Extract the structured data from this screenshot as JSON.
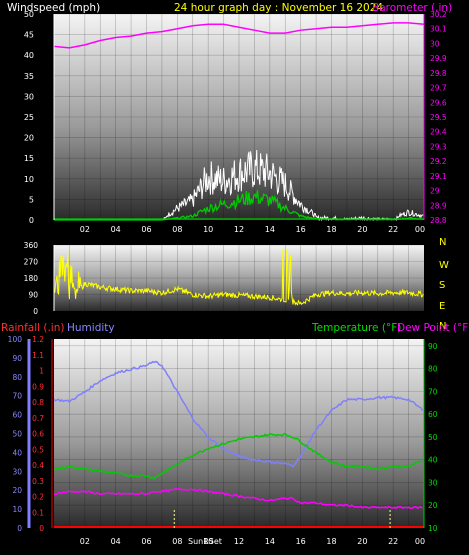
{
  "header": {
    "left_title": "Windspeed (mph)",
    "center_title": "24 hour graph day : November 16 2024",
    "right_title": "Barometer (.in)"
  },
  "colors": {
    "background": "#000000",
    "wind_axis": "#ffffff",
    "barometer": "#ff00ff",
    "gust": "#ffffff",
    "avg_wind": "#00cc00",
    "direction": "#ffff00",
    "rainfall": "#ff0000",
    "humidity": "#7f7fff",
    "temperature": "#00cc00",
    "dewpoint": "#ff00ff",
    "sunrise_marker": "#ffff88"
  },
  "x_ticks": [
    "02",
    "04",
    "06",
    "08",
    "10",
    "12",
    "14",
    "16",
    "18",
    "20",
    "22",
    "00"
  ],
  "compass": [
    "N",
    "W",
    "S",
    "E",
    "N"
  ],
  "chart_data": [
    {
      "type": "line",
      "x": [
        0,
        1,
        2,
        3,
        4,
        5,
        6,
        7,
        8,
        9,
        10,
        11,
        12,
        13,
        14,
        15,
        16,
        17,
        18,
        19,
        20,
        21,
        22,
        23,
        24
      ],
      "series": [
        {
          "name": "Barometer (.in)",
          "axis": "right",
          "values": [
            29.98,
            29.97,
            29.99,
            30.02,
            30.04,
            30.05,
            30.07,
            30.08,
            30.1,
            30.12,
            30.13,
            30.13,
            30.11,
            30.09,
            30.07,
            30.07,
            30.09,
            30.1,
            30.11,
            30.11,
            30.12,
            30.13,
            30.14,
            30.14,
            30.13
          ]
        },
        {
          "values": [
            0,
            0,
            0,
            0.3,
            0,
            0,
            0,
            0.2,
            3,
            5,
            11,
            10,
            12,
            13,
            12,
            9,
            4,
            1,
            1,
            0.5,
            1,
            0.5,
            0.5,
            2,
            1
          ]
        },
        {
          "values": [
            0,
            0,
            0,
            0,
            0,
            0,
            0,
            0,
            0.5,
            1,
            3,
            4,
            5,
            6,
            5,
            3,
            1,
            0.3,
            0.2,
            0.1,
            0.2,
            0.1,
            0.1,
            0.5,
            0.2
          ]
        }
      ],
      "left_axis": {
        "label": "Windspeed (mph)",
        "ylim": [
          0,
          50
        ],
        "ticks": [
          0,
          5,
          10,
          15,
          20,
          25,
          30,
          35,
          40,
          45,
          50
        ]
      },
      "right_axis": {
        "label": "Barometer (.in)",
        "ylim": [
          28.8,
          30.2
        ],
        "ticks": [
          "28.8",
          "28.9",
          "29",
          "29.1",
          "29.2",
          "29.3",
          "29.4",
          "29.5",
          "29.6",
          "29.7",
          "29.8",
          "29.9",
          "30",
          "30.1",
          "30.2"
        ]
      }
    },
    {
      "type": "line",
      "x": [
        0,
        0.5,
        1,
        1.5,
        2,
        3,
        4,
        5,
        6,
        7,
        8,
        9,
        10,
        11,
        12,
        13,
        14,
        15,
        15.5,
        16,
        17,
        18,
        19,
        20,
        21,
        22,
        23,
        24
      ],
      "series": [
        {
          "values": [
            90,
            340,
            180,
            100,
            150,
            130,
            120,
            110,
            110,
            100,
            120,
            90,
            80,
            90,
            85,
            80,
            75,
            60,
            50,
            40,
            90,
            100,
            95,
            100,
            95,
            100,
            100,
            90
          ]
        }
      ],
      "left_axis": {
        "ticks": [
          0,
          90,
          180,
          270,
          360
        ],
        "ylim": [
          0,
          360
        ]
      },
      "right_axis": {
        "ticks": [
          "N",
          "W",
          "S",
          "E",
          "N"
        ]
      }
    },
    {
      "type": "line",
      "x": [
        0,
        1,
        2,
        3,
        4,
        5,
        6,
        6.5,
        7,
        8,
        9,
        10,
        11,
        12,
        13,
        14,
        15,
        15.5,
        16,
        17,
        18,
        19,
        20,
        21,
        22,
        23,
        24
      ],
      "series": [
        {
          "name": "Humidity",
          "axis": "humidity",
          "values": [
            68,
            67,
            72,
            78,
            82,
            84,
            86,
            88,
            86,
            72,
            58,
            48,
            42,
            38,
            36,
            35,
            34,
            33,
            38,
            52,
            62,
            68,
            68,
            69,
            69,
            68,
            62
          ]
        },
        {
          "name": "Temperature (°F)",
          "axis": "right",
          "values": [
            36,
            37,
            36,
            35,
            34,
            33,
            33,
            32,
            34,
            38,
            42,
            45,
            47,
            49,
            50,
            51,
            51,
            50,
            48,
            43,
            39,
            37,
            37,
            36,
            37,
            37,
            40
          ]
        },
        {
          "name": "Dew Point (°F)",
          "axis": "right",
          "values": [
            25,
            26,
            26,
            25,
            25,
            25,
            25,
            26,
            26,
            27,
            27,
            26,
            25,
            24,
            23,
            22,
            23,
            23,
            21,
            21,
            20,
            20,
            19,
            19,
            19,
            19,
            19
          ]
        },
        {
          "name": "Rainfall (.in)",
          "axis": "rain",
          "values": [
            0,
            0,
            0,
            0,
            0,
            0,
            0,
            0,
            0,
            0,
            0,
            0,
            0,
            0,
            0,
            0,
            0,
            0,
            0,
            0,
            0,
            0,
            0,
            0,
            0,
            0,
            0
          ]
        }
      ],
      "rain_axis": {
        "label": "Rainfall (.in)",
        "ylim": [
          0,
          1.2
        ],
        "ticks": [
          "0",
          "0.1",
          "0.2",
          "0.3",
          "0.4",
          "0.5",
          "0.6",
          "0.7",
          "0.8",
          "0.9",
          "1",
          "1.1",
          "1.2"
        ]
      },
      "humidity_axis": {
        "label": "Humidity",
        "ylim": [
          0,
          100
        ],
        "ticks": [
          0,
          10,
          20,
          30,
          40,
          50,
          60,
          70,
          80,
          90,
          100
        ]
      },
      "right_axis": {
        "label": "Temperature (°F)  Dew Point (°F)",
        "ylim": [
          10,
          93
        ],
        "ticks": [
          10,
          20,
          30,
          40,
          50,
          60,
          70,
          80,
          90
        ]
      },
      "annotations": [
        "SunRSet"
      ],
      "sun_markers_hours": [
        7.8,
        21.8
      ]
    }
  ],
  "bottom_labels": {
    "rainfall": "Rainfall (.in)",
    "humidity": "Humidity",
    "temperature": "Temperature (°F)",
    "dewpoint": "Dew Point (°F)",
    "sun": "SunRSet"
  }
}
